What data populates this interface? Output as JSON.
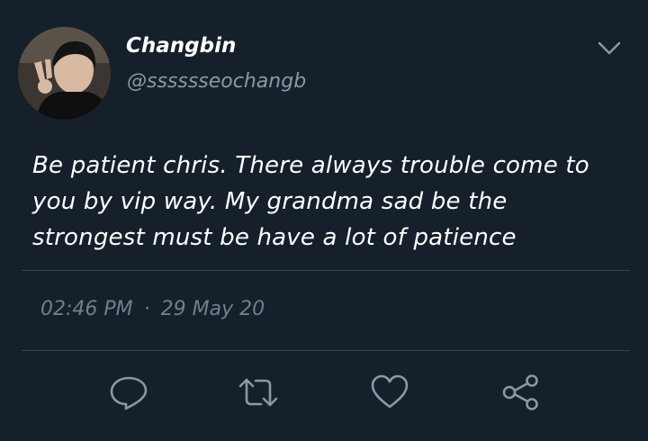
{
  "author": {
    "display_name": "Changbin",
    "handle": "@sssssseochangb"
  },
  "tweet": {
    "text": "Be patient chris. There always trouble come to you by vip way. My grandma sad be the strongest must be have a lot of patience",
    "time": "02:46 PM",
    "separator": "·",
    "date": "29 May 20"
  },
  "icons": {
    "menu": "chevron-down-icon",
    "reply": "reply-icon",
    "retweet": "retweet-icon",
    "like": "heart-icon",
    "share": "share-icon"
  },
  "colors": {
    "background": "#15202b",
    "text": "#ffffff",
    "secondary_text": "#8899a6",
    "icon": "#8899a6",
    "divider": "#38444d"
  }
}
